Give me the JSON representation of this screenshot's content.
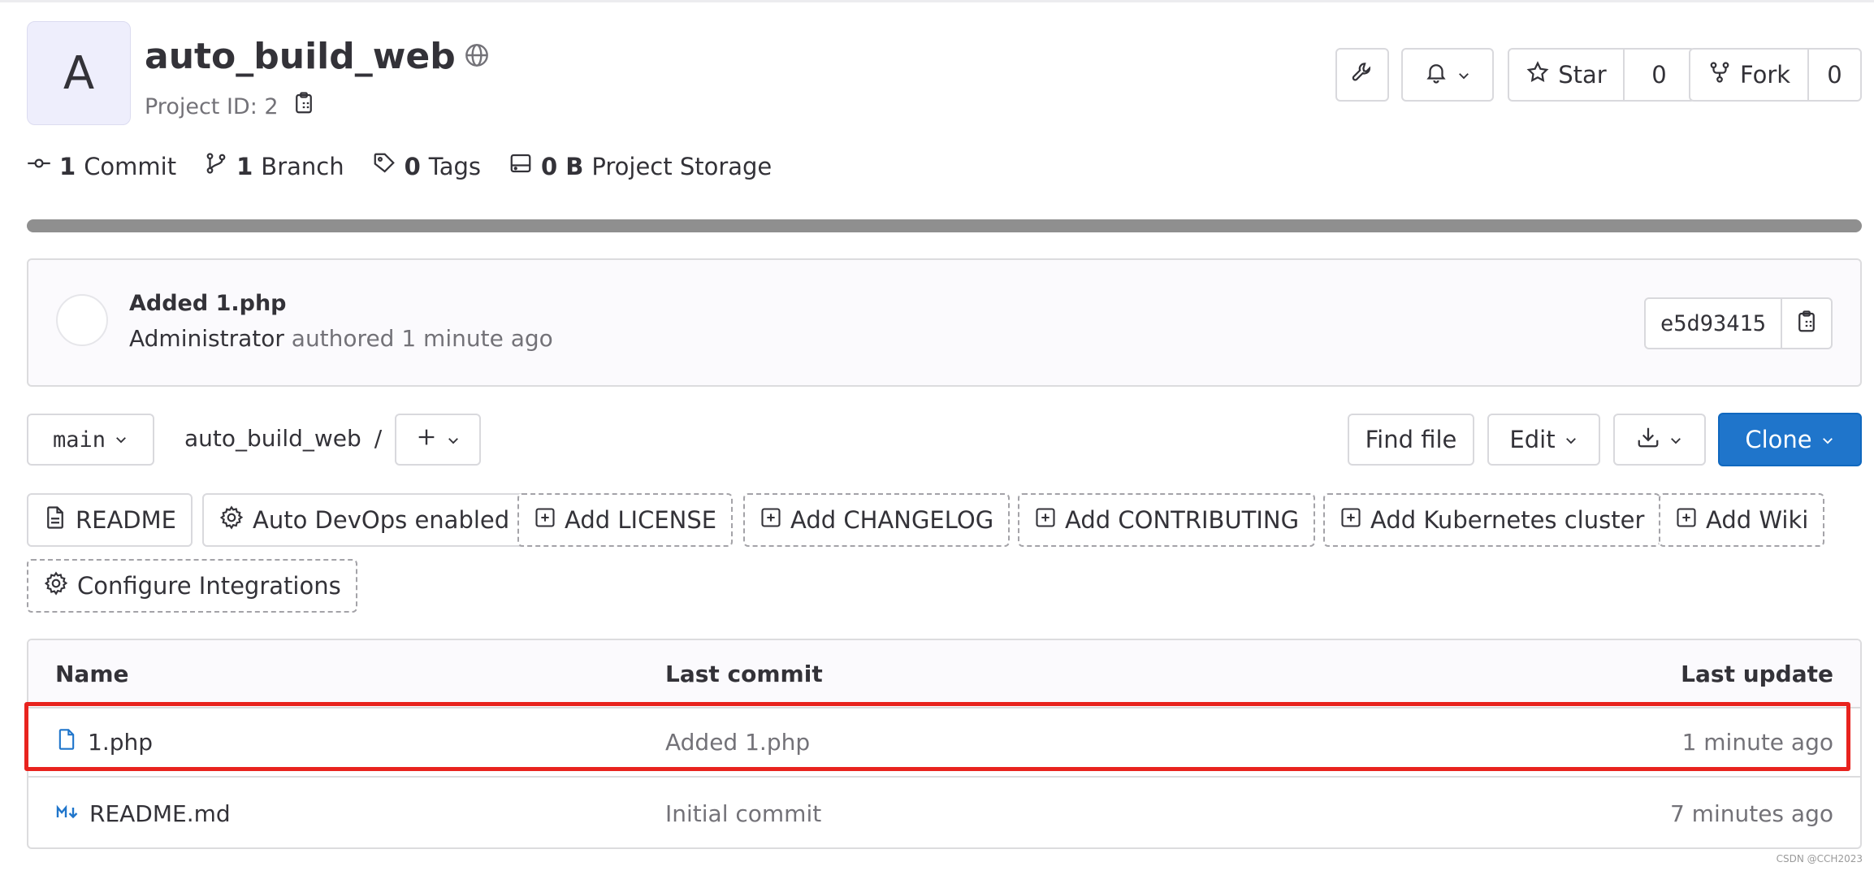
{
  "project": {
    "avatar_letter": "A",
    "name": "auto_build_web",
    "id_text": "Project ID: 2"
  },
  "header_actions": {
    "star_label": "Star",
    "star_count": "0",
    "fork_label": "Fork",
    "fork_count": "0"
  },
  "stats": {
    "commits_count": "1",
    "commits_label": "Commit",
    "branches_count": "1",
    "branches_label": "Branch",
    "tags_count": "0",
    "tags_label": "Tags",
    "storage_count": "0 B",
    "storage_label": "Project Storage"
  },
  "last_commit": {
    "title": "Added 1.php",
    "author": "Administrator",
    "meta": "authored 1 minute ago",
    "sha": "e5d93415"
  },
  "repo_toolbar": {
    "branch": "main",
    "breadcrumb_root": "auto_build_web",
    "breadcrumb_sep": "/",
    "find_file": "Find file",
    "edit": "Edit",
    "clone": "Clone"
  },
  "quick_actions": [
    {
      "label": "README",
      "icon": "file-icon",
      "style": "solid"
    },
    {
      "label": "Auto DevOps enabled",
      "icon": "gear-icon",
      "style": "solid"
    },
    {
      "label": "Add LICENSE",
      "icon": "plus-square-icon",
      "style": "dashed"
    },
    {
      "label": "Add CHANGELOG",
      "icon": "plus-square-icon",
      "style": "dashed"
    },
    {
      "label": "Add CONTRIBUTING",
      "icon": "plus-square-icon",
      "style": "dashed"
    },
    {
      "label": "Add Kubernetes cluster",
      "icon": "plus-square-icon",
      "style": "dashed"
    },
    {
      "label": "Add Wiki",
      "icon": "plus-square-icon",
      "style": "dashed"
    },
    {
      "label": "Configure Integrations",
      "icon": "gear-icon",
      "style": "dashed"
    }
  ],
  "file_table": {
    "headers": {
      "name": "Name",
      "last_commit": "Last commit",
      "last_update": "Last update"
    },
    "rows": [
      {
        "name": "1.php",
        "icon": "file-icon",
        "commit": "Added 1.php",
        "updated": "1 minute ago"
      },
      {
        "name": "README.md",
        "icon": "markdown-icon",
        "commit": "Initial commit",
        "updated": "7 minutes ago"
      }
    ]
  },
  "watermark": "CSDN @CCH2023",
  "colors": {
    "primary_blue": "#1f75cb",
    "highlight_red": "#e8231e",
    "icon_blue": "#1f75cb"
  }
}
